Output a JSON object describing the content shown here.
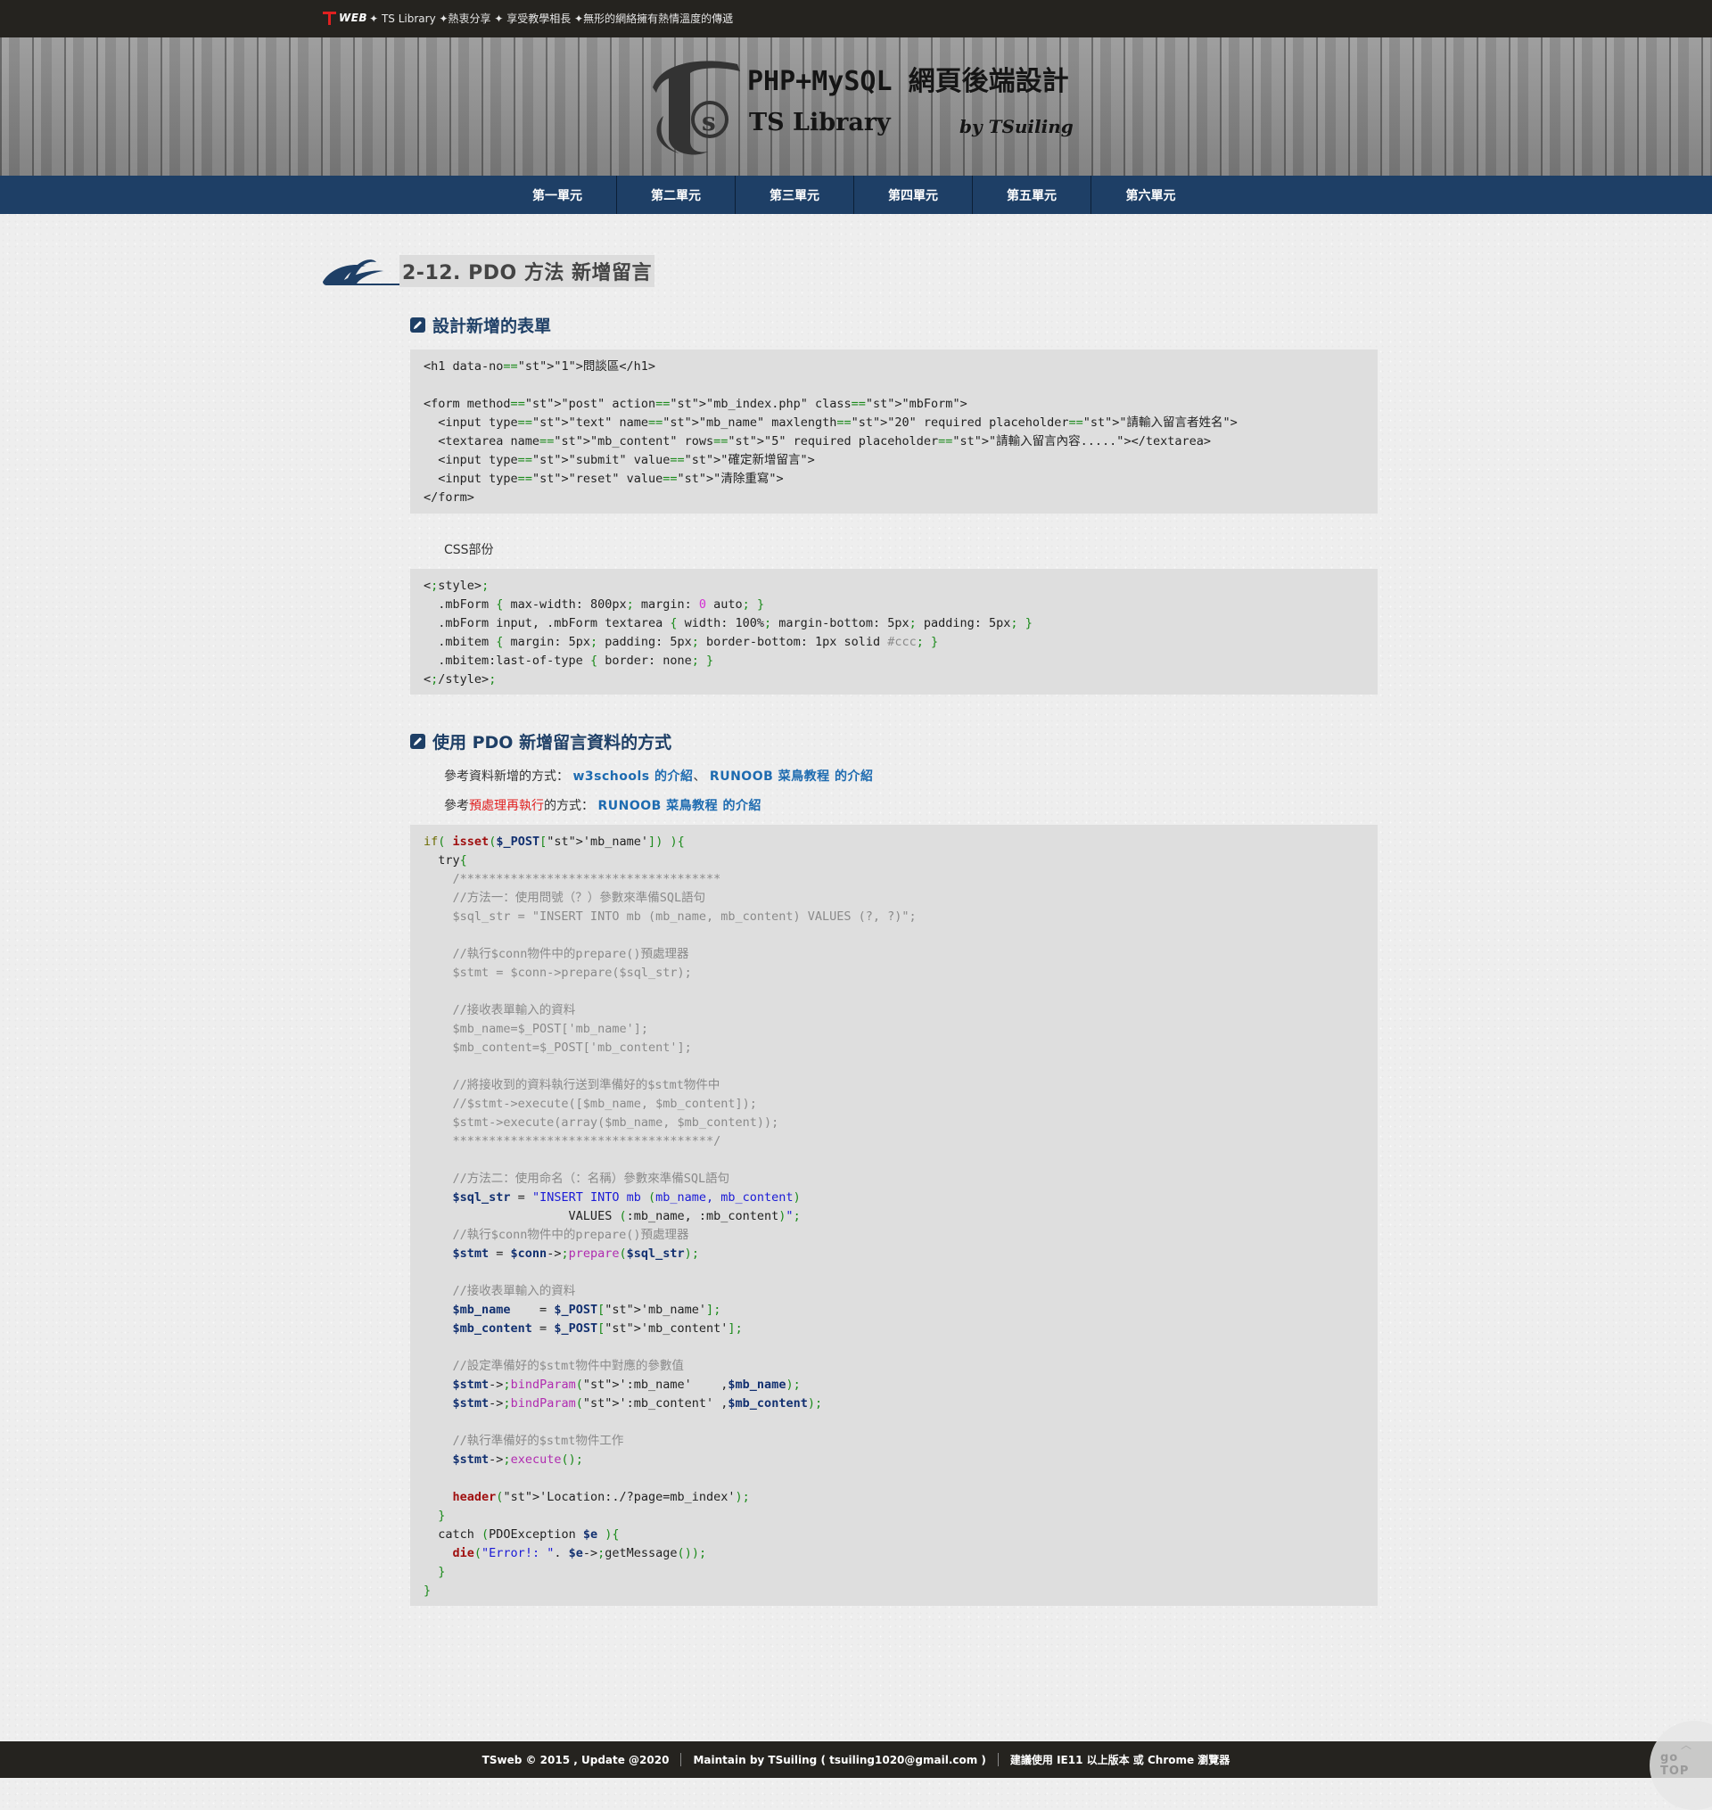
{
  "topbar": {
    "web_label": "WEB",
    "text": "✦ TS Library ✦熱衷分享 ✦ 享受教學相長 ✦無形的網絡擁有熱情溫度的傳遞"
  },
  "banner": {
    "title": "PHP+MySQL 網頁後端設計",
    "subtitle": "TS Library",
    "byline": "by TSuiling"
  },
  "nav": [
    "第一單元",
    "第二單元",
    "第三單元",
    "第四單元",
    "第五單元",
    "第六單元"
  ],
  "page_title": "2-12. PDO 方法 新增留言",
  "section1": {
    "title": "設計新增的表單",
    "css_label": "CSS部份"
  },
  "section2": {
    "title": "使用 PDO 新增留言資料的方式",
    "ref1_prefix": "參考資料新增的方式：",
    "ref1_link1": "w3schools 的介紹",
    "ref1_sep": "、",
    "ref1_link2": "RUNOOB 菜鳥教程 的介紹",
    "ref2_prefix": "參考",
    "ref2_red": "預處理再執行",
    "ref2_mid": "的方式：",
    "ref2_link": "RUNOOB 菜鳥教程 的介紹"
  },
  "html_code": [
    "<h1 data-no=\"1\">問談區</h1>",
    "",
    "<form method=\"post\" action=\"mb_index.php\" class=\"mbForm\">",
    "  <input type=\"text\" name=\"mb_name\" maxlength=\"20\" required placeholder=\"請輸入留言者姓名\">",
    "  <textarea name=\"mb_content\" rows=\"5\" required placeholder=\"請輸入留言內容.....\"></textarea>",
    "  <input type=\"submit\" value=\"確定新增留言\">",
    "  <input type=\"reset\" value=\"清除重寫\">",
    "</form>"
  ],
  "css_code": [
    "<style>",
    "  .mbForm { max-width: 800px; margin: 0 auto; }",
    "  .mbForm input, .mbForm textarea { width: 100%; margin-bottom: 5px; padding: 5px; }",
    "  .mbitem { margin: 5px; padding: 5px; border-bottom: 1px solid #ccc; }",
    "  .mbitem:last-of-type { border: none; }",
    "</style>"
  ],
  "php_code": [
    "if( isset($_POST['mb_name']) ){",
    "  try{",
    "    /************************************",
    "    //方法一：使用問號（？）參數來準備SQL語句",
    "    $sql_str = \"INSERT INTO mb (mb_name, mb_content) VALUES (?, ?)\";",
    "",
    "    //執行$conn物件中的prepare()預處理器",
    "    $stmt = $conn->prepare($sql_str);",
    "",
    "    //接收表單輸入的資料",
    "    $mb_name=$_POST['mb_name'];",
    "    $mb_content=$_POST['mb_content'];",
    "",
    "    //將接收到的資料執行送到準備好的$stmt物件中",
    "    //$stmt->execute([$mb_name, $mb_content]);",
    "    $stmt->execute(array($mb_name, $mb_content));",
    "    ************************************/",
    "",
    "    //方法二：使用命名（：名稱）參數來準備SQL語句",
    "    $sql_str = \"INSERT INTO mb (mb_name, mb_content)",
    "                    VALUES (:mb_name, :mb_content)\";",
    "    //執行$conn物件中的prepare()預處理器",
    "    $stmt = $conn->prepare($sql_str);",
    "",
    "    //接收表單輸入的資料",
    "    $mb_name    = $_POST['mb_name'];",
    "    $mb_content = $_POST['mb_content'];",
    "",
    "    //設定準備好的$stmt物件中對應的參數值",
    "    $stmt->bindParam(':mb_name'    ,$mb_name);",
    "    $stmt->bindParam(':mb_content' ,$mb_content);",
    "",
    "    //執行準備好的$stmt物件工作",
    "    $stmt->execute();",
    "",
    "    header('Location:./?page=mb_index');",
    "  }",
    "  catch (PDOException $e ){",
    "    die(\"Error!: \". $e->getMessage());",
    "  }",
    "}"
  ],
  "footer": {
    "copyright": "TSweb © 2015 , Update @2020",
    "maintain": "Maintain by TSuiling ( tsuiling1020@gmail.com )",
    "browser": "建議使用 IE11 以上版本 或 Chrome 瀏覽器"
  },
  "gotop": {
    "label": "go TOP",
    "icon": "chevron-up-icon"
  },
  "colors": {
    "nav": "#1e3f66",
    "topbar": "#25231f",
    "code_bg": "#dedede",
    "link": "#1e6bb0"
  }
}
